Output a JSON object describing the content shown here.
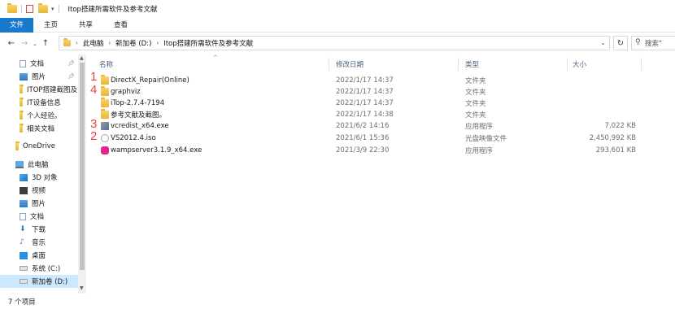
{
  "window": {
    "title": "Itop搭建所需软件及参考文献"
  },
  "ribbon": {
    "tabs": [
      "文件",
      "主页",
      "共享",
      "查看"
    ]
  },
  "address": {
    "segments": [
      "此电脑",
      "新加卷 (D:)",
      "Itop搭建所需软件及参考文献"
    ],
    "search_placeholder": "搜索\""
  },
  "sidebar": {
    "quick_access": [
      {
        "label": "文档",
        "icon": "document-icon",
        "pinned": true
      },
      {
        "label": "图片",
        "icon": "pictures-icon",
        "pinned": true
      },
      {
        "label": "ITOP搭建截图及",
        "icon": "folder-icon",
        "pinned": false
      },
      {
        "label": "IT设备信息",
        "icon": "folder-icon",
        "pinned": false
      },
      {
        "label": "个人经验。",
        "icon": "folder-icon",
        "pinned": false
      },
      {
        "label": "相关文档",
        "icon": "folder-icon",
        "pinned": false
      }
    ],
    "onedrive": {
      "label": "OneDrive",
      "icon": "cloud-icon"
    },
    "this_pc": {
      "label": "此电脑",
      "icon": "computer-icon"
    },
    "pc_items": [
      {
        "label": "3D 对象",
        "icon": "3d-objects-icon"
      },
      {
        "label": "视频",
        "icon": "videos-icon"
      },
      {
        "label": "图片",
        "icon": "pictures-icon"
      },
      {
        "label": "文档",
        "icon": "document-icon"
      },
      {
        "label": "下载",
        "icon": "download-icon"
      },
      {
        "label": "音乐",
        "icon": "music-icon"
      },
      {
        "label": "桌面",
        "icon": "desktop-icon"
      },
      {
        "label": "系统 (C:)",
        "icon": "drive-icon"
      },
      {
        "label": "新加卷 (D:)",
        "icon": "drive-icon",
        "selected": true
      }
    ]
  },
  "columns": {
    "name": "名称",
    "date": "修改日期",
    "type": "类型",
    "size": "大小"
  },
  "files": [
    {
      "name": "DirectX_Repair(Online)",
      "date": "2022/1/17 14:37",
      "type": "文件夹",
      "size": "",
      "icon": "folder-icon",
      "annotation": "1"
    },
    {
      "name": "graphviz",
      "date": "2022/1/17 14:37",
      "type": "文件夹",
      "size": "",
      "icon": "folder-icon",
      "annotation": "4"
    },
    {
      "name": "iTop-2.7.4-7194",
      "date": "2022/1/17 14:37",
      "type": "文件夹",
      "size": "",
      "icon": "folder-icon",
      "annotation": ""
    },
    {
      "name": "参考文献及截图。",
      "date": "2022/1/17 14:38",
      "type": "文件夹",
      "size": "",
      "icon": "folder-icon",
      "annotation": ""
    },
    {
      "name": "vcredist_x64.exe",
      "date": "2021/6/2 14:16",
      "type": "应用程序",
      "size": "7,022 KB",
      "icon": "installer-icon",
      "annotation": "3"
    },
    {
      "name": "VS2012.4.iso",
      "date": "2021/6/1 15:36",
      "type": "光盘映像文件",
      "size": "2,450,992 KB",
      "icon": "disc-image-icon",
      "annotation": "2"
    },
    {
      "name": "wampserver3.1.9_x64.exe",
      "date": "2021/3/9 22:30",
      "type": "应用程序",
      "size": "293,601 KB",
      "icon": "wampserver-icon",
      "annotation": ""
    }
  ],
  "status": {
    "item_count": "7 个项目"
  }
}
